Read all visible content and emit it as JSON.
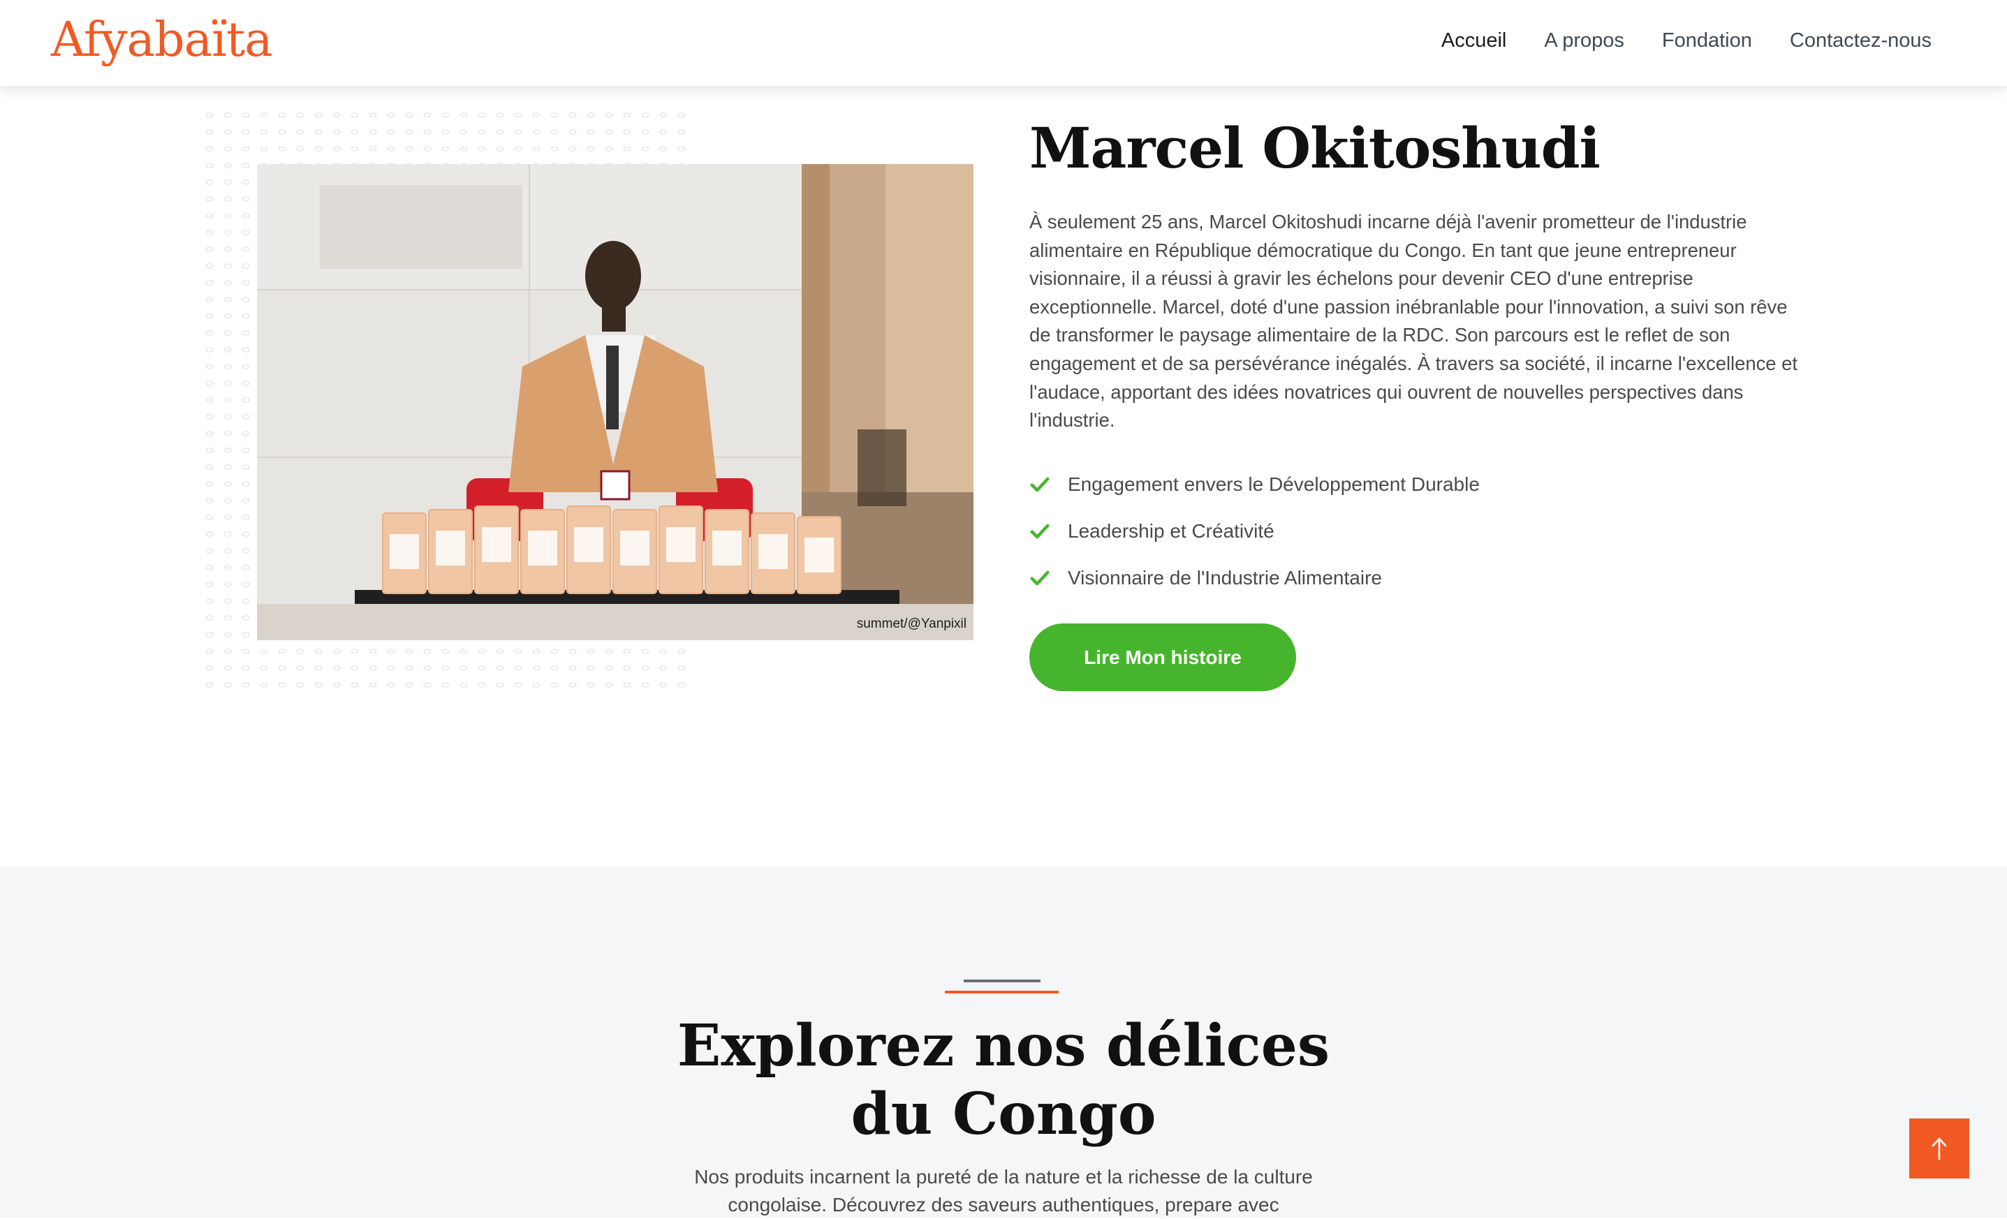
{
  "header": {
    "logo": "Afyabaïta",
    "nav": [
      {
        "label": "Accueil",
        "active": true
      },
      {
        "label": "A propos",
        "active": false
      },
      {
        "label": "Fondation",
        "active": false
      },
      {
        "label": "Contactez-nous",
        "active": false
      }
    ]
  },
  "hero": {
    "photo_credit": "summet/@Yanpixil",
    "title": "Marcel Okitoshudi",
    "description": "À seulement 25 ans, Marcel Okitoshudi incarne déjà l'avenir prometteur de l'industrie alimentaire en République démocratique du Congo. En tant que jeune entrepreneur visionnaire, il a réussi à gravir les échelons pour devenir CEO d'une entreprise exceptionnelle. Marcel, doté d'une passion inébranlable pour l'innovation, a suivi son rêve de transformer le paysage alimentaire de la RDC. Son parcours est le reflet de son engagement et de sa persévérance inégalés. À travers sa société, il incarne l'excellence et l'audace, apportant des idées novatrices qui ouvrent de nouvelles perspectives dans l'industrie.",
    "features": [
      "Engagement envers le Développement Durable",
      "Leadership et Créativité",
      "Visionnaire de l'Industrie Alimentaire"
    ],
    "cta_label": "Lire Mon histoire"
  },
  "explore": {
    "title_line1": "Explorez nos délices",
    "title_line2": "du Congo",
    "description": "Nos produits incarnent la pureté de la nature et la richesse de la culture congolaise. Découvrez des saveurs authentiques, prepare avec"
  },
  "icons": {
    "check": "check-icon",
    "back_to_top": "arrow-up-icon"
  },
  "colors": {
    "brand": "#f15a24",
    "accent_green": "#46b52d",
    "section_bg": "#f5f6f8"
  }
}
